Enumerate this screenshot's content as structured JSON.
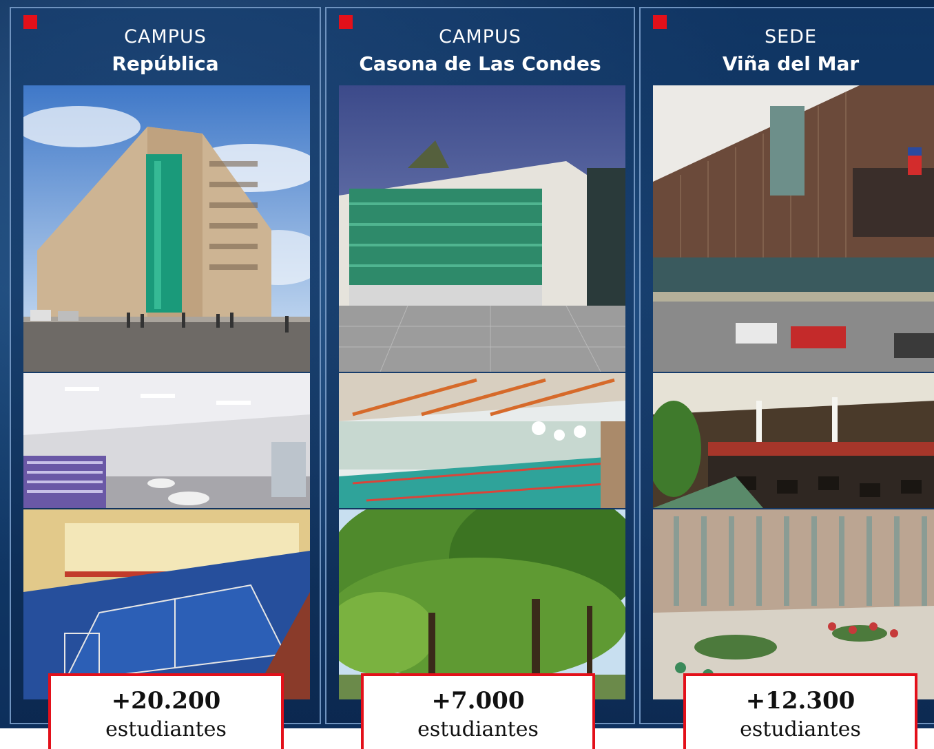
{
  "colors": {
    "accent_red": "#e3101a",
    "panel_border": "#6f93bf",
    "background_blue": "#14406f"
  },
  "campuses": [
    {
      "kind": "CAMPUS",
      "name": "República",
      "count": "+20.200",
      "count_label": "estudiantes"
    },
    {
      "kind": "CAMPUS",
      "name": "Casona de Las Condes",
      "count": "+7.000",
      "count_label": "estudiantes"
    },
    {
      "kind": "SEDE",
      "name": "Viña del Mar",
      "count": "+12.300",
      "count_label": "estudiantes"
    }
  ]
}
